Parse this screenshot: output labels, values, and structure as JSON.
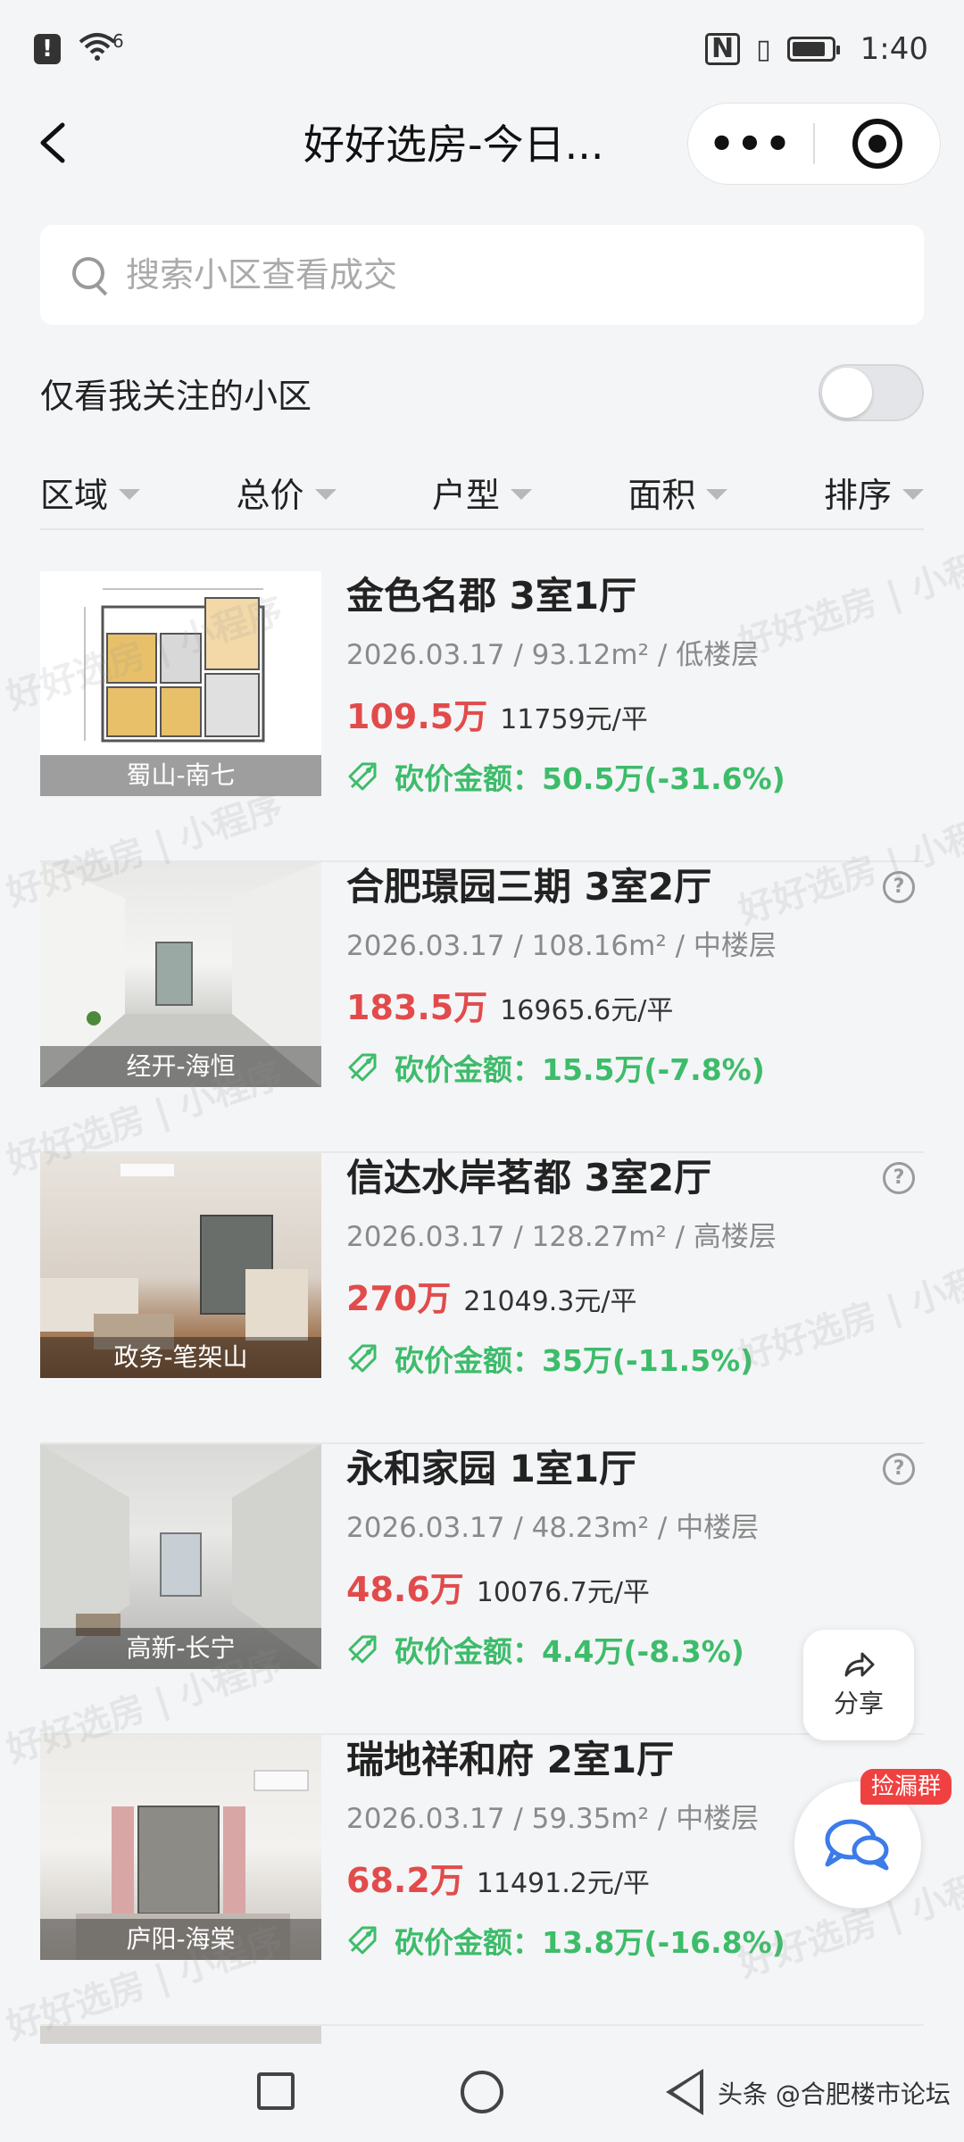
{
  "status_bar": {
    "time": "1:40",
    "signal": "6",
    "alert": "!"
  },
  "nav": {
    "title": "好好选房-今日...",
    "more": "•••"
  },
  "search": {
    "placeholder": "搜索小区查看成交"
  },
  "follow_toggle": {
    "label": "仅看我关注的小区",
    "enabled": false
  },
  "filters": [
    "区域",
    "总价",
    "户型",
    "面积",
    "排序"
  ],
  "listings": [
    {
      "title": "金色名郡 3室1厅",
      "date": "2026.03.17",
      "area": "93.12m²",
      "floor": "低楼层",
      "total": "109.5万",
      "unit_price": "11759元/平",
      "cut": "砍价金额：50.5万(-31.6%)",
      "district": "蜀山-南七",
      "has_help": false
    },
    {
      "title": "合肥璟园三期 3室2厅",
      "date": "2026.03.17",
      "area": "108.16m²",
      "floor": "中楼层",
      "total": "183.5万",
      "unit_price": "16965.6元/平",
      "cut": "砍价金额：15.5万(-7.8%)",
      "district": "经开-海恒",
      "has_help": true
    },
    {
      "title": "信达水岸茗都 3室2厅",
      "date": "2026.03.17",
      "area": "128.27m²",
      "floor": "高楼层",
      "total": "270万",
      "unit_price": "21049.3元/平",
      "cut": "砍价金额：35万(-11.5%)",
      "district": "政务-笔架山",
      "has_help": true
    },
    {
      "title": "永和家园 1室1厅",
      "date": "2026.03.17",
      "area": "48.23m²",
      "floor": "中楼层",
      "total": "48.6万",
      "unit_price": "10076.7元/平",
      "cut": "砍价金额：4.4万(-8.3%)",
      "district": "高新-长宁",
      "has_help": true
    },
    {
      "title": "瑞地祥和府 2室1厅",
      "date": "2026.03.17",
      "area": "59.35m²",
      "floor": "中楼层",
      "total": "68.2万",
      "unit_price": "11491.2元/平",
      "cut": "砍价金额：13.8万(-16.8%)",
      "district": "庐阳-海棠",
      "has_help": true
    }
  ],
  "floating": {
    "share_label": "分享",
    "chat_badge": "捡漏群"
  },
  "watermark": {
    "text": "好好选房 | 小程序"
  },
  "credit": "头条 @合肥楼市论坛",
  "colors": {
    "price_red": "#e24b4b",
    "cut_green": "#3dbc6a",
    "badge_red": "#f04141",
    "chat_blue": "#3c7be8"
  }
}
